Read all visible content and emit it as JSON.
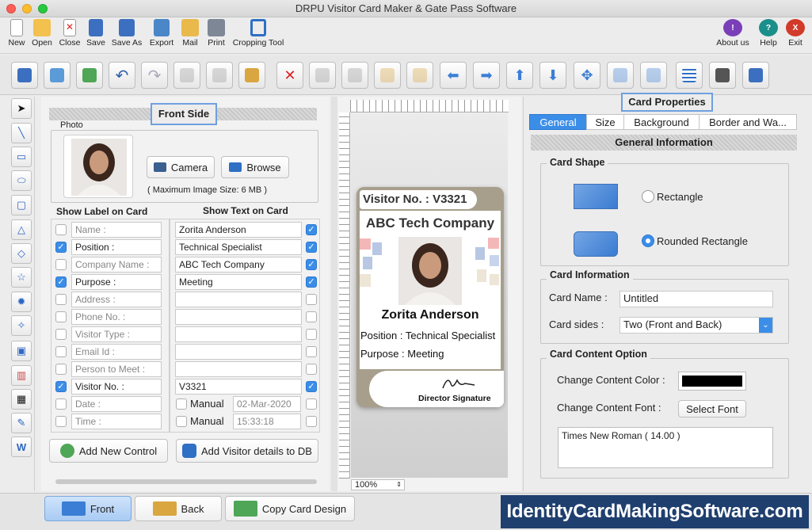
{
  "window": {
    "title": "DRPU Visitor Card Maker & Gate Pass Software"
  },
  "menu": {
    "items": [
      {
        "label": "New",
        "icon": "new-doc-icon"
      },
      {
        "label": "Open",
        "icon": "folder-open-icon"
      },
      {
        "label": "Close",
        "icon": "close-doc-icon"
      },
      {
        "label": "Save",
        "icon": "save-icon"
      },
      {
        "label": "Save As",
        "icon": "save-as-icon"
      },
      {
        "label": "Export",
        "icon": "export-icon"
      },
      {
        "label": "Mail",
        "icon": "mail-icon"
      },
      {
        "label": "Print",
        "icon": "print-icon"
      },
      {
        "label": "Cropping Tool",
        "icon": "crop-icon"
      }
    ],
    "right": [
      {
        "label": "About us",
        "icon": "info-icon",
        "color": "#7a3fb8"
      },
      {
        "label": "Help",
        "icon": "help-icon",
        "color": "#1b8f8a"
      },
      {
        "label": "Exit",
        "icon": "exit-icon",
        "color": "#d23a2a"
      }
    ]
  },
  "front": {
    "header": "Front Side",
    "photo_legend": "Photo",
    "camera": "Camera",
    "browse": "Browse",
    "max_size": "( Maximum Image Size: 6 MB )",
    "col_label": "Show Label on Card",
    "col_text": "Show Text on Card",
    "rows": [
      {
        "label": "Name :",
        "text": "Zorita Anderson"
      },
      {
        "label": "Position :",
        "text": "Technical Specialist"
      },
      {
        "label": "Company Name :",
        "text": "ABC Tech Company"
      },
      {
        "label": "Purpose :",
        "text": "Meeting"
      },
      {
        "label": "Address :",
        "text": ""
      },
      {
        "label": "Phone No. :",
        "text": ""
      },
      {
        "label": "Visitor Type :",
        "text": ""
      },
      {
        "label": "Email Id :",
        "text": ""
      },
      {
        "label": "Person to Meet :",
        "text": ""
      },
      {
        "label": "Visitor No. :",
        "text": "V3321"
      },
      {
        "label": "Date :",
        "manual": "Manual",
        "text": "02-Mar-2020"
      },
      {
        "label": "Time :",
        "manual": "Manual",
        "text": "15:33:18"
      }
    ],
    "add_control": "Add New Control",
    "add_db": "Add Visitor details to DB"
  },
  "card": {
    "visitor_no": "Visitor No. :  V3321",
    "company": "ABC Tech Company",
    "name": "Zorita Anderson",
    "position": "Position : Technical Specialist",
    "purpose": "Purpose : Meeting",
    "signature": "Director Signature",
    "zoom": "100%"
  },
  "props": {
    "header": "Card Properties",
    "tabs": [
      "General",
      "Size",
      "Background",
      "Border and Wa..."
    ],
    "section": "General Information",
    "shape_legend": "Card Shape",
    "rect": "Rectangle",
    "rounded": "Rounded Rectangle",
    "info_legend": "Card Information",
    "card_name_label": "Card Name :",
    "card_name": "Untitled",
    "sides_label": "Card sides :",
    "sides": "Two (Front and Back)",
    "content_legend": "Card Content Option",
    "color_label": "Change Content Color :",
    "content_color": "#000000",
    "font_label": "Change Content Font :",
    "select_font": "Select Font",
    "font_value": "Times New Roman ( 14.00 )"
  },
  "bottom": {
    "front": "Front",
    "back": "Back",
    "copy": "Copy Card Design",
    "brand": "IdentityCardMakingSoftware.com"
  }
}
